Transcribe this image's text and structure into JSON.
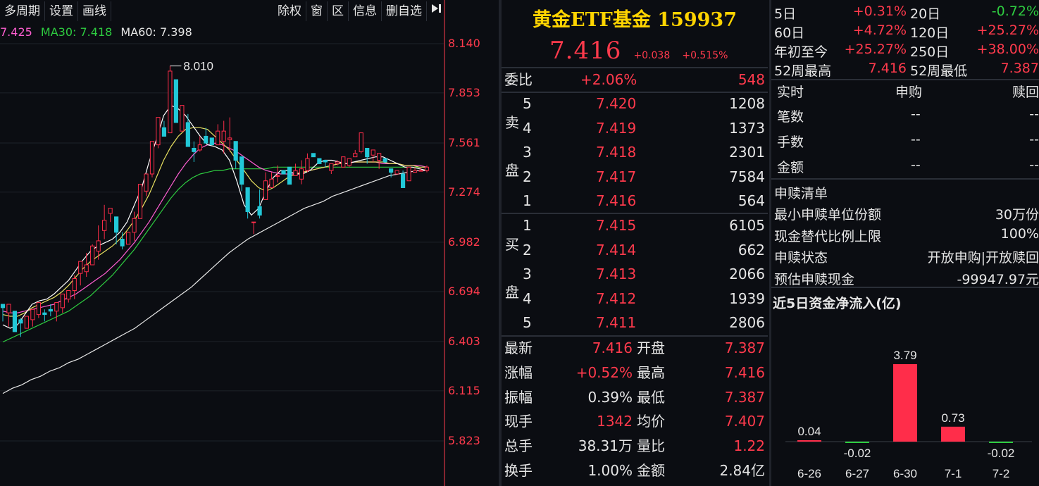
{
  "toolbar": {
    "left": [
      "多周期",
      "设置",
      "画线"
    ],
    "right": [
      "除权",
      "窗",
      "区",
      "信息",
      "删自选"
    ],
    "collapse_icon": "arrow-right-bar-icon"
  },
  "ma_legend": [
    {
      "text": "7.425",
      "color": "#ff5fd2"
    },
    {
      "text": "MA30: 7.418",
      "color": "#2ecc40"
    },
    {
      "text": "MA60: 7.398",
      "color": "#e6e6e6"
    }
  ],
  "kline": {
    "y_ticks": [
      "8.140",
      "7.853",
      "7.561",
      "7.274",
      "6.982",
      "6.694",
      "6.403",
      "6.115",
      "5.823"
    ],
    "y_range": [
      5.823,
      8.14
    ],
    "high_marker": "8.010",
    "candles": [
      [
        6.62,
        6.6,
        6.56,
        6.52
      ],
      [
        6.57,
        6.62,
        6.54,
        6.49
      ],
      [
        6.58,
        6.46,
        6.45,
        6.52
      ],
      [
        6.53,
        6.51,
        6.54,
        6.43
      ],
      [
        6.48,
        6.55,
        6.53,
        6.5
      ],
      [
        6.53,
        6.59,
        6.59,
        6.49
      ],
      [
        6.56,
        6.63,
        6.57,
        6.54
      ],
      [
        6.57,
        6.56,
        6.59,
        6.52
      ],
      [
        6.59,
        6.58,
        6.62,
        6.55
      ],
      [
        6.58,
        6.63,
        6.55,
        6.52
      ],
      [
        6.6,
        6.68,
        6.66,
        6.57
      ],
      [
        6.65,
        6.7,
        6.66,
        6.63
      ],
      [
        6.7,
        6.77,
        6.79,
        6.65
      ],
      [
        6.8,
        6.87,
        6.77,
        6.73
      ],
      [
        6.81,
        6.85,
        6.92,
        6.78
      ],
      [
        6.85,
        6.96,
        6.97,
        6.86
      ],
      [
        6.93,
        6.99,
        7.08,
        6.88
      ],
      [
        7.05,
        7.11,
        7.2,
        7.0
      ],
      [
        7.15,
        7.18,
        7.18,
        7.1
      ],
      [
        7.13,
        7.04,
        7.13,
        6.97
      ],
      [
        7.0,
        6.96,
        7.04,
        6.94
      ],
      [
        6.97,
        7.04,
        7.01,
        6.99
      ],
      [
        7.04,
        7.12,
        7.16,
        6.99
      ],
      [
        7.12,
        7.32,
        7.28,
        7.13
      ],
      [
        7.28,
        7.38,
        7.36,
        7.25
      ],
      [
        7.38,
        7.57,
        7.53,
        7.36
      ],
      [
        7.55,
        7.71,
        7.69,
        7.53
      ],
      [
        7.65,
        7.6,
        7.69,
        7.6
      ],
      [
        7.62,
        7.98,
        8.01,
        7.65
      ],
      [
        7.93,
        7.68,
        7.75,
        7.75
      ],
      [
        7.63,
        7.78,
        7.77,
        7.63
      ],
      [
        7.68,
        7.54,
        7.73,
        7.54
      ],
      [
        7.53,
        7.51,
        7.57,
        7.45
      ],
      [
        7.52,
        7.55,
        7.6,
        7.51
      ],
      [
        7.6,
        7.56,
        7.65,
        7.6
      ],
      [
        7.59,
        7.55,
        7.57,
        7.56
      ],
      [
        7.55,
        7.63,
        7.67,
        7.57
      ],
      [
        7.57,
        7.63,
        7.69,
        7.5
      ],
      [
        7.58,
        7.59,
        7.71,
        7.51
      ],
      [
        7.57,
        7.46,
        7.52,
        7.41
      ],
      [
        7.48,
        7.32,
        7.45,
        7.28
      ],
      [
        7.3,
        7.16,
        7.13,
        7.12
      ],
      [
        7.1,
        7.1,
        7.07,
        7.03
      ],
      [
        7.19,
        7.14,
        7.29,
        7.12
      ],
      [
        7.23,
        7.34,
        7.39,
        7.27
      ],
      [
        7.3,
        7.35,
        7.39,
        7.31
      ],
      [
        7.37,
        7.37,
        7.43,
        7.33
      ],
      [
        7.4,
        7.38,
        7.36,
        7.39
      ],
      [
        7.42,
        7.32,
        7.29,
        7.39
      ],
      [
        7.37,
        7.4,
        7.44,
        7.39
      ],
      [
        7.35,
        7.41,
        7.46,
        7.32
      ],
      [
        7.4,
        7.47,
        7.5,
        7.39
      ],
      [
        7.5,
        7.48,
        7.49,
        7.48
      ],
      [
        7.47,
        7.44,
        7.42,
        7.48
      ],
      [
        7.46,
        7.45,
        7.45,
        7.42
      ],
      [
        7.4,
        7.44,
        7.43,
        7.38
      ],
      [
        7.44,
        7.45,
        7.46,
        7.43
      ],
      [
        7.42,
        7.48,
        7.47,
        7.44
      ],
      [
        7.43,
        7.47,
        7.47,
        7.42
      ],
      [
        7.48,
        7.5,
        7.52,
        7.53
      ],
      [
        7.51,
        7.62,
        7.6,
        7.5
      ],
      [
        7.53,
        7.48,
        7.5,
        7.44
      ],
      [
        7.49,
        7.52,
        7.5,
        7.45
      ],
      [
        7.46,
        7.5,
        7.45,
        7.41
      ],
      [
        7.47,
        7.45,
        7.44,
        7.44
      ],
      [
        7.41,
        7.39,
        7.38,
        7.36
      ],
      [
        7.38,
        7.4,
        7.37,
        7.39
      ],
      [
        7.38,
        7.3,
        7.4,
        7.31
      ],
      [
        7.34,
        7.42,
        7.42,
        7.37
      ],
      [
        7.39,
        7.4,
        7.42,
        7.39
      ],
      [
        7.4,
        7.4,
        7.42,
        7.4
      ],
      [
        7.4,
        7.42,
        7.43,
        7.39
      ]
    ],
    "ma_white_short": [
      6.5,
      6.48,
      6.5,
      6.56,
      6.62,
      6.64,
      6.65,
      6.68,
      6.72,
      6.76,
      6.82,
      6.88,
      6.93,
      6.96,
      6.98,
      7.0,
      7.04,
      7.1,
      7.2,
      7.3,
      7.45,
      7.58,
      7.72,
      7.78,
      7.76,
      7.72,
      7.66,
      7.6,
      7.55,
      7.54,
      7.52,
      7.46,
      7.34,
      7.2,
      7.14,
      7.18,
      7.28,
      7.36,
      7.4,
      7.4,
      7.38,
      7.38,
      7.4,
      7.44,
      7.46,
      7.46,
      7.45,
      7.44,
      7.45,
      7.46,
      7.47,
      7.48,
      7.48,
      7.46,
      7.44,
      7.42,
      7.42,
      7.41,
      7.4
    ],
    "ma_yellow": [
      6.56,
      6.55,
      6.55,
      6.57,
      6.6,
      6.62,
      6.64,
      6.66,
      6.69,
      6.73,
      6.78,
      6.83,
      6.87,
      6.9,
      6.93,
      6.96,
      7.0,
      7.05,
      7.11,
      7.18,
      7.26,
      7.36,
      7.46,
      7.54,
      7.6,
      7.64,
      7.65,
      7.65,
      7.64,
      7.6,
      7.56,
      7.52,
      7.46,
      7.4,
      7.34,
      7.3,
      7.28,
      7.3,
      7.33,
      7.36,
      7.38,
      7.39,
      7.4,
      7.41,
      7.42,
      7.43,
      7.44,
      7.44,
      7.45,
      7.45,
      7.45,
      7.45,
      7.45,
      7.44,
      7.44,
      7.43,
      7.43,
      7.42,
      7.42
    ],
    "ma_magenta": [
      6.58,
      6.57,
      6.57,
      6.58,
      6.59,
      6.6,
      6.61,
      6.62,
      6.64,
      6.66,
      6.68,
      6.71,
      6.74,
      6.77,
      6.8,
      6.84,
      6.88,
      6.93,
      6.98,
      7.04,
      7.1,
      7.17,
      7.24,
      7.31,
      7.38,
      7.44,
      7.49,
      7.53,
      7.55,
      7.56,
      7.55,
      7.53,
      7.51,
      7.48,
      7.45,
      7.42,
      7.4,
      7.39,
      7.38,
      7.38,
      7.38,
      7.39,
      7.4,
      7.41,
      7.42,
      7.43,
      7.44,
      7.44,
      7.45,
      7.45,
      7.45,
      7.45,
      7.44,
      7.44,
      7.44,
      7.43,
      7.43,
      7.43,
      7.42
    ],
    "ma_green": [
      6.4,
      6.42,
      6.44,
      6.46,
      6.48,
      6.5,
      6.52,
      6.54,
      6.56,
      6.58,
      6.61,
      6.64,
      6.67,
      6.71,
      6.75,
      6.79,
      6.84,
      6.89,
      6.94,
      7.0,
      7.06,
      7.12,
      7.18,
      7.24,
      7.29,
      7.33,
      7.36,
      7.38,
      7.39,
      7.4,
      7.4,
      7.41,
      7.41,
      7.41,
      7.41,
      7.41,
      7.41,
      7.42,
      7.42,
      7.42,
      7.42,
      7.42,
      7.42,
      7.42,
      7.42,
      7.42,
      7.42,
      7.42,
      7.42,
      7.42,
      7.42,
      7.42,
      7.42,
      7.42,
      7.42,
      7.42,
      7.42,
      7.42,
      7.42
    ],
    "ma_white_long": [
      6.1,
      6.13,
      6.15,
      6.18,
      6.2,
      6.23,
      6.25,
      6.28,
      6.3,
      6.33,
      6.36,
      6.39,
      6.42,
      6.45,
      6.48,
      6.52,
      6.56,
      6.6,
      6.64,
      6.68,
      6.72,
      6.77,
      6.82,
      6.87,
      6.92,
      6.96,
      7.0,
      7.03,
      7.06,
      7.09,
      7.12,
      7.15,
      7.18,
      7.2,
      7.22,
      7.25,
      7.27,
      7.29,
      7.31,
      7.33,
      7.35,
      7.37,
      7.38,
      7.39,
      7.4,
      7.4
    ]
  },
  "quote": {
    "title": "黄金ETF基金 159937",
    "price": "7.416",
    "change": "+0.038",
    "change_pct": "+0.515%",
    "webi_label": "委比",
    "webi_pct": "+2.06%",
    "webi_diff": "548",
    "sell_label": [
      "卖",
      "盘"
    ],
    "buy_label": [
      "买",
      "盘"
    ],
    "sell": [
      {
        "level": "5",
        "price": "7.420",
        "vol": "1208"
      },
      {
        "level": "4",
        "price": "7.419",
        "vol": "1373"
      },
      {
        "level": "3",
        "price": "7.418",
        "vol": "2301"
      },
      {
        "level": "2",
        "price": "7.417",
        "vol": "7584"
      },
      {
        "level": "1",
        "price": "7.416",
        "vol": "564"
      }
    ],
    "buy": [
      {
        "level": "1",
        "price": "7.415",
        "vol": "6105"
      },
      {
        "level": "2",
        "price": "7.414",
        "vol": "662"
      },
      {
        "level": "3",
        "price": "7.413",
        "vol": "2066"
      },
      {
        "level": "4",
        "price": "7.412",
        "vol": "1939"
      },
      {
        "level": "5",
        "price": "7.411",
        "vol": "2806"
      }
    ],
    "stats": [
      {
        "l1": "最新",
        "v1": "7.416",
        "c1": "red",
        "l2": "开盘",
        "v2": "7.387",
        "c2": "red"
      },
      {
        "l1": "涨幅",
        "v1": "+0.52%",
        "c1": "red",
        "l2": "最高",
        "v2": "7.416",
        "c2": "red"
      },
      {
        "l1": "振幅",
        "v1": "0.39%",
        "c1": "white",
        "l2": "最低",
        "v2": "7.387",
        "c2": "red"
      },
      {
        "l1": "现手",
        "v1": "1342",
        "c1": "red",
        "l2": "均价",
        "v2": "7.407",
        "c2": "red"
      },
      {
        "l1": "总手",
        "v1": "38.31万",
        "c1": "white",
        "l2": "量比",
        "v2": "1.22",
        "c2": "red"
      },
      {
        "l1": "换手",
        "v1": "1.00%",
        "c1": "white",
        "l2": "金额",
        "v2": "2.84亿",
        "c2": "white"
      }
    ]
  },
  "right": {
    "perf": [
      {
        "l1": "5日",
        "v1": "+0.31%",
        "c1": "red",
        "l2": "20日",
        "v2": "-0.72%",
        "c2": "green"
      },
      {
        "l1": "60日",
        "v1": "+4.72%",
        "c1": "red",
        "l2": "120日",
        "v2": "+25.27%",
        "c2": "red"
      },
      {
        "l1": "年初至今",
        "v1": "+25.27%",
        "c1": "red",
        "l2": "250日",
        "v2": "+38.00%",
        "c2": "red"
      },
      {
        "l1": "52周最高",
        "v1": "7.416",
        "c1": "red",
        "l2": "52周最低",
        "v2": "7.387",
        "c2": "red"
      }
    ],
    "realtime_header": [
      "实时",
      "申购",
      "赎回"
    ],
    "realtime": [
      {
        "label": "笔数",
        "sub": "--",
        "red": "--"
      },
      {
        "label": "手数",
        "sub": "--",
        "red": "--"
      },
      {
        "label": "金额",
        "sub": "--",
        "red": "--"
      }
    ],
    "list_title": "申赎清单",
    "list": [
      {
        "label": "最小申赎单位份额",
        "value": "30万份"
      },
      {
        "label": "现金替代比例上限",
        "value": "100%"
      },
      {
        "label": "申赎状态",
        "value": "开放申购|开放赎回"
      },
      {
        "label": "预估申赎现金",
        "value": "-99947.97元"
      }
    ],
    "flow_title": "近5日资金净流入(亿)"
  },
  "chart_data": {
    "type": "bar",
    "title": "近5日资金净流入(亿)",
    "categories": [
      "6-26",
      "6-27",
      "6-30",
      "7-1",
      "7-2"
    ],
    "values": [
      0.04,
      -0.02,
      3.79,
      0.73,
      -0.02
    ],
    "labels": [
      "0.04",
      "-0.02",
      "3.79",
      "0.73",
      "-0.02"
    ],
    "colors": {
      "positive": "#ff2d4a",
      "negative": "#2ecc40"
    }
  }
}
